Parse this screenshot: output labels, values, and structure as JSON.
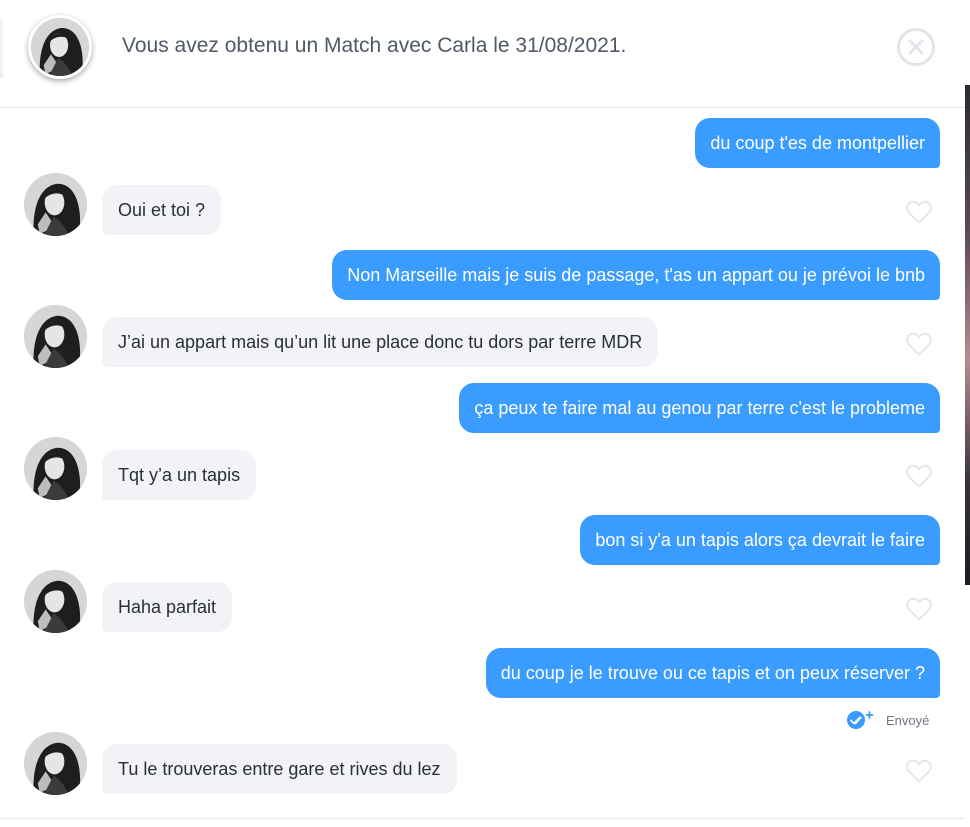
{
  "header": {
    "match_text": "Vous avez obtenu un Match avec Carla le 31/08/2021."
  },
  "conversation": {
    "status_text": "Envoyé",
    "messages": [
      {
        "direction": "out",
        "text": "du coup t'es de montpellier"
      },
      {
        "direction": "in",
        "text": "Oui et toi ?"
      },
      {
        "direction": "out",
        "text": "Non Marseille mais je suis de passage, t'as un appart ou je prévoi le bnb"
      },
      {
        "direction": "in",
        "text": "J’ai un appart mais qu’un lit une place donc tu dors par terre MDR"
      },
      {
        "direction": "out",
        "text": "ça peux te faire mal au genou par terre c'est le probleme"
      },
      {
        "direction": "in",
        "text": "Tqt y’a un tapis"
      },
      {
        "direction": "out",
        "text": "bon si y'a un tapis alors ça devrait le faire"
      },
      {
        "direction": "in",
        "text": "Haha parfait"
      },
      {
        "direction": "out",
        "text": "du coup je le trouve ou ce tapis et on peux réserver ?"
      },
      {
        "direction": "in",
        "text": "Tu le trouveras entre gare et rives du lez"
      }
    ]
  },
  "colors": {
    "outgoing_bubble": "#3a9cff",
    "incoming_bubble": "#f2f3f7",
    "header_text": "#505965"
  },
  "icons": {
    "close": "close-icon",
    "like": "heart-icon",
    "sent": "sent-check-icon"
  }
}
